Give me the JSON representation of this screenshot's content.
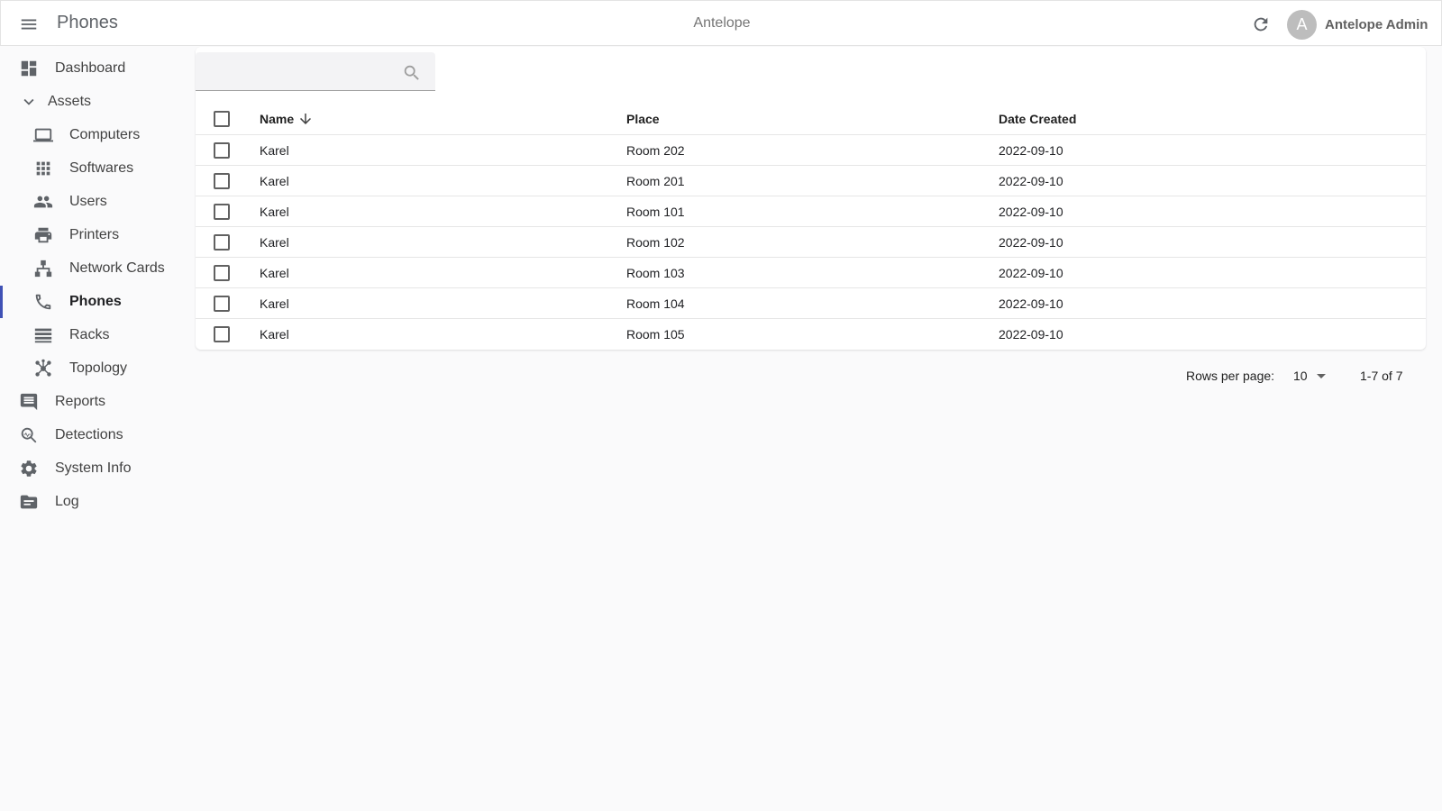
{
  "app_bar": {
    "title": "Phones",
    "brand": "Antelope",
    "user": {
      "avatar_letter": "A",
      "name": "Antelope Admin"
    },
    "icons": {
      "menu": "menu-icon",
      "refresh": "refresh-icon"
    }
  },
  "sidebar": {
    "items": [
      {
        "label": "Dashboard",
        "icon": "dashboard-icon",
        "level": "top"
      },
      {
        "label": "Assets",
        "icon": "chevron-down-icon",
        "level": "top",
        "expanded": true
      },
      {
        "label": "Computers",
        "icon": "laptop-icon",
        "level": "sub"
      },
      {
        "label": "Softwares",
        "icon": "apps-grid-icon",
        "level": "sub"
      },
      {
        "label": "Users",
        "icon": "people-icon",
        "level": "sub"
      },
      {
        "label": "Printers",
        "icon": "printer-icon",
        "level": "sub"
      },
      {
        "label": "Network Cards",
        "icon": "network-icon",
        "level": "sub"
      },
      {
        "label": "Phones",
        "icon": "phone-icon",
        "level": "sub",
        "active": true
      },
      {
        "label": "Racks",
        "icon": "list-icon",
        "level": "sub"
      },
      {
        "label": "Topology",
        "icon": "topology-icon",
        "level": "sub"
      },
      {
        "label": "Reports",
        "icon": "comment-icon",
        "level": "top"
      },
      {
        "label": "Detections",
        "icon": "search-activity-icon",
        "level": "top"
      },
      {
        "label": "System Info",
        "icon": "gear-icon",
        "level": "top"
      },
      {
        "label": "Log",
        "icon": "folder-icon",
        "level": "top"
      }
    ]
  },
  "search": {
    "value": "",
    "placeholder": "",
    "icon": "search-icon"
  },
  "table": {
    "columns": [
      "Name",
      "Place",
      "Date Created"
    ],
    "sort": {
      "column": "Name",
      "direction": "desc"
    },
    "rows": [
      {
        "name": "Karel",
        "place": "Room 202",
        "date": "2022-09-10"
      },
      {
        "name": "Karel",
        "place": "Room 201",
        "date": "2022-09-10"
      },
      {
        "name": "Karel",
        "place": "Room 101",
        "date": "2022-09-10"
      },
      {
        "name": "Karel",
        "place": "Room 102",
        "date": "2022-09-10"
      },
      {
        "name": "Karel",
        "place": "Room 103",
        "date": "2022-09-10"
      },
      {
        "name": "Karel",
        "place": "Room 104",
        "date": "2022-09-10"
      },
      {
        "name": "Karel",
        "place": "Room 105",
        "date": "2022-09-10"
      }
    ]
  },
  "pagination": {
    "rows_per_page_label": "Rows per page:",
    "rows_per_page": "10",
    "range": "1-7 of 7"
  },
  "colors": {
    "accent": "#3f51b5",
    "icon": "#5f6368",
    "background": "#fafafb"
  }
}
